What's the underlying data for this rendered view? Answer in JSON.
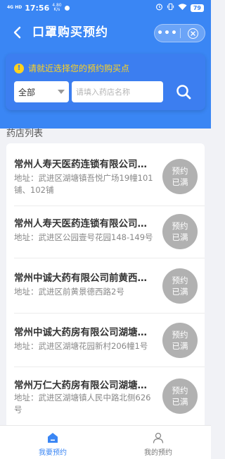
{
  "status_bar": {
    "signal": "4G HD",
    "time": "17:56",
    "net_speed_value": "4.80",
    "net_speed_unit": "K/s",
    "battery": "79"
  },
  "nav": {
    "title": "口罩购买预约",
    "more": "•••"
  },
  "search": {
    "hint": "请就近选择您的预约购买点",
    "district_selected": "全部",
    "placeholder": "请填入药店名称"
  },
  "list_title": "药店列表",
  "pharmacies": [
    {
      "name": "常州人寿天医药连锁有限公司达…",
      "addr_line1": "地址：武进区湖塘镇吾悦广场19幢101",
      "addr_line2": "铺、102铺",
      "badge_line1": "预约",
      "badge_line2": "已满"
    },
    {
      "name": "常州人寿天医药连锁有限公司健…",
      "addr_line1": "地址：武进区公园壹号花园148-149号",
      "addr_line2": "",
      "badge_line1": "预约",
      "badge_line2": "已满"
    },
    {
      "name": "常州中诚大药有限公司前黄西街…",
      "addr_line1": "地址：武进区前黄景德西路2号",
      "addr_line2": "",
      "badge_line1": "预约",
      "badge_line2": "已满"
    },
    {
      "name": "常州中诚大药房有限公司湖塘润…",
      "addr_line1": "地址：武进区湖塘花园新村206幢1号",
      "addr_line2": "",
      "badge_line1": "预约",
      "badge_line2": "已满"
    },
    {
      "name": "常州万仁大药房有限公司湖塘人…",
      "addr_line1": "地址：武进区湖塘镇人民中路北侧626",
      "addr_line2": "号",
      "badge_line1": "预约",
      "badge_line2": "已满"
    }
  ],
  "tabs": [
    {
      "label": "我要预约",
      "icon": "home-icon",
      "active": true
    },
    {
      "label": "我的预约",
      "icon": "person-icon",
      "active": false
    }
  ],
  "colors": {
    "primary": "#3a86f4",
    "hint": "#ffd21e",
    "badge": "#b1b1b1"
  }
}
